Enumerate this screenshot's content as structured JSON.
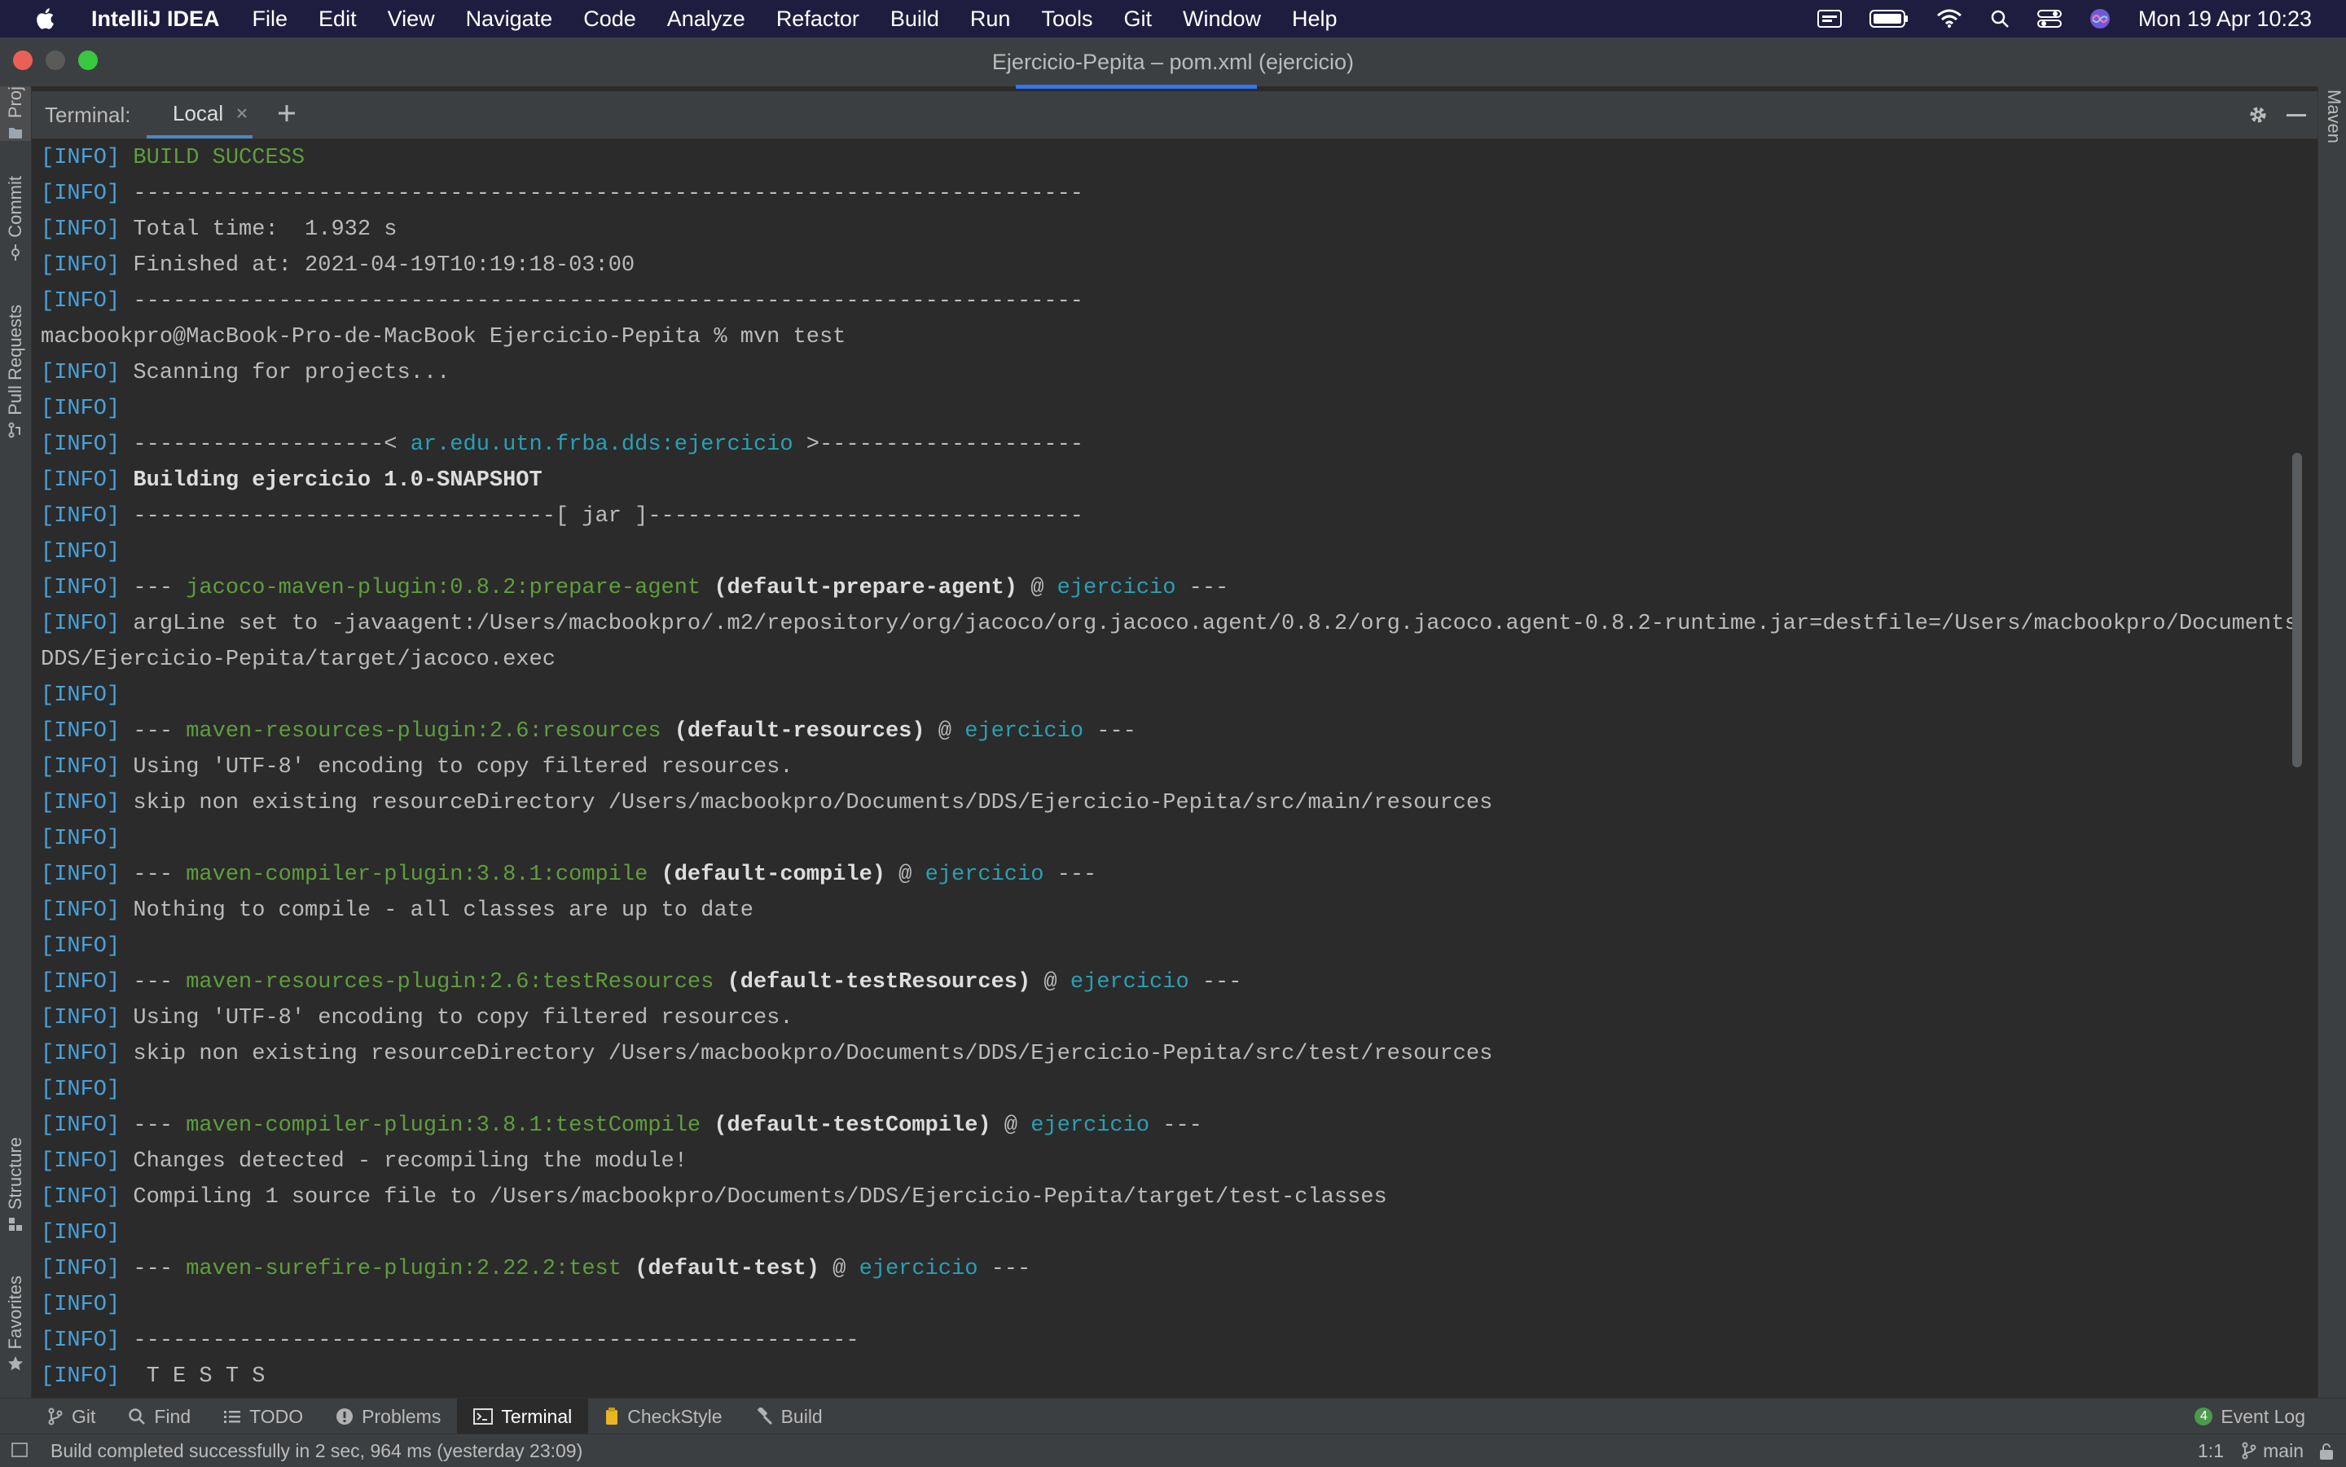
{
  "menubar": {
    "app_name": "IntelliJ IDEA",
    "menus": [
      "File",
      "Edit",
      "View",
      "Navigate",
      "Code",
      "Analyze",
      "Refactor",
      "Build",
      "Run",
      "Tools",
      "Git",
      "Window",
      "Help"
    ],
    "clock": "Mon 19 Apr  10:23",
    "status_icons": [
      "input-source-icon",
      "battery-icon",
      "wifi-icon",
      "spotlight-icon",
      "control-center-icon",
      "siri-icon"
    ]
  },
  "window": {
    "title": "Ejercicio-Pepita – pom.xml (ejercicio)"
  },
  "left_stripe": {
    "project": "Proj",
    "commit": "Commit",
    "pull_requests": "Pull Requests",
    "structure": "Structure",
    "favorites": "Favorites"
  },
  "right_stripe": {
    "maven": "Maven"
  },
  "terminal": {
    "label": "Terminal:",
    "tab_label": "Local",
    "lines": [
      {
        "info": "[INFO]",
        "text": " ",
        "ok": "BUILD SUCCESS"
      },
      {
        "info": "[INFO]",
        "text": " ------------------------------------------------------------------------"
      },
      {
        "info": "[INFO]",
        "text": " Total time:  1.932 s"
      },
      {
        "info": "[INFO]",
        "text": " Finished at: 2021-04-19T10:19:18-03:00"
      },
      {
        "info": "[INFO]",
        "text": " ------------------------------------------------------------------------"
      },
      {
        "text": "macbookpro@MacBook-Pro-de-MacBook Ejercicio-Pepita % mvn test"
      },
      {
        "info": "[INFO]",
        "text": " Scanning for projects..."
      },
      {
        "info": "[INFO]",
        "text": ""
      },
      {
        "info": "[INFO]",
        "text": " -------------------< ",
        "proj": "ar.edu.utn.frba.dds:ejercicio",
        "text2": " >--------------------"
      },
      {
        "info": "[INFO]",
        "text": " ",
        "bold": "Building ejercicio 1.0-SNAPSHOT"
      },
      {
        "info": "[INFO]",
        "text": " --------------------------------[ jar ]---------------------------------"
      },
      {
        "info": "[INFO]",
        "text": ""
      },
      {
        "info": "[INFO]",
        "text": " --- ",
        "plugin": "jacoco-maven-plugin:0.8.2:prepare-agent",
        "bold2": " (default-prepare-agent)",
        "text3": " @ ",
        "proj2": "ejercicio",
        "text4": " ---"
      },
      {
        "info": "[INFO]",
        "text": " argLine set to -javaagent:/Users/macbookpro/.m2/repository/org/jacoco/org.jacoco.agent/0.8.2/org.jacoco.agent-0.8.2-runtime.jar=destfile=/Users/macbookpro/Documents/"
      },
      {
        "text": "DDS/Ejercicio-Pepita/target/jacoco.exec"
      },
      {
        "info": "[INFO]",
        "text": ""
      },
      {
        "info": "[INFO]",
        "text": " --- ",
        "plugin": "maven-resources-plugin:2.6:resources",
        "bold2": " (default-resources)",
        "text3": " @ ",
        "proj2": "ejercicio",
        "text4": " ---"
      },
      {
        "info": "[INFO]",
        "text": " Using 'UTF-8' encoding to copy filtered resources."
      },
      {
        "info": "[INFO]",
        "text": " skip non existing resourceDirectory /Users/macbookpro/Documents/DDS/Ejercicio-Pepita/src/main/resources"
      },
      {
        "info": "[INFO]",
        "text": ""
      },
      {
        "info": "[INFO]",
        "text": " --- ",
        "plugin": "maven-compiler-plugin:3.8.1:compile",
        "bold2": " (default-compile)",
        "text3": " @ ",
        "proj2": "ejercicio",
        "text4": " ---"
      },
      {
        "info": "[INFO]",
        "text": " Nothing to compile - all classes are up to date"
      },
      {
        "info": "[INFO]",
        "text": ""
      },
      {
        "info": "[INFO]",
        "text": " --- ",
        "plugin": "maven-resources-plugin:2.6:testResources",
        "bold2": " (default-testResources)",
        "text3": " @ ",
        "proj2": "ejercicio",
        "text4": " ---"
      },
      {
        "info": "[INFO]",
        "text": " Using 'UTF-8' encoding to copy filtered resources."
      },
      {
        "info": "[INFO]",
        "text": " skip non existing resourceDirectory /Users/macbookpro/Documents/DDS/Ejercicio-Pepita/src/test/resources"
      },
      {
        "info": "[INFO]",
        "text": ""
      },
      {
        "info": "[INFO]",
        "text": " --- ",
        "plugin": "maven-compiler-plugin:3.8.1:testCompile",
        "bold2": " (default-testCompile)",
        "text3": " @ ",
        "proj2": "ejercicio",
        "text4": " ---"
      },
      {
        "info": "[INFO]",
        "text": " Changes detected - recompiling the module!"
      },
      {
        "info": "[INFO]",
        "text": " Compiling 1 source file to /Users/macbookpro/Documents/DDS/Ejercicio-Pepita/target/test-classes"
      },
      {
        "info": "[INFO]",
        "text": ""
      },
      {
        "info": "[INFO]",
        "text": " --- ",
        "plugin": "maven-surefire-plugin:2.22.2:test",
        "bold2": " (default-test)",
        "text3": " @ ",
        "proj2": "ejercicio",
        "text4": " ---"
      },
      {
        "info": "[INFO]",
        "text": ""
      },
      {
        "info": "[INFO]",
        "text": " -------------------------------------------------------"
      },
      {
        "info": "[INFO]",
        "text": "  T E S T S"
      }
    ]
  },
  "tool_windows": [
    {
      "label": "Git",
      "icon": "git-branch-icon",
      "active": false
    },
    {
      "label": "Find",
      "icon": "search-icon",
      "active": false
    },
    {
      "label": "TODO",
      "icon": "list-icon",
      "active": false
    },
    {
      "label": "Problems",
      "icon": "warning-icon",
      "active": false
    },
    {
      "label": "Terminal",
      "icon": "terminal-icon",
      "active": true
    },
    {
      "label": "CheckStyle",
      "icon": "checkstyle-icon",
      "active": false
    },
    {
      "label": "Build",
      "icon": "hammer-icon",
      "active": false
    }
  ],
  "event_log": {
    "label": "Event Log",
    "count": "4"
  },
  "statusbar": {
    "message": "Build completed successfully in 2 sec, 964 ms (yesterday 23:09)",
    "position": "1:1",
    "branch": "main"
  },
  "colors": {
    "menubar_bg": "#1f1d3f",
    "editor_bg": "#2b2b2b",
    "panel_bg": "#3c3f41",
    "info_blue": "#4aa1d8",
    "success_green": "#5e9e3c",
    "project_cyan": "#29a0b3"
  }
}
